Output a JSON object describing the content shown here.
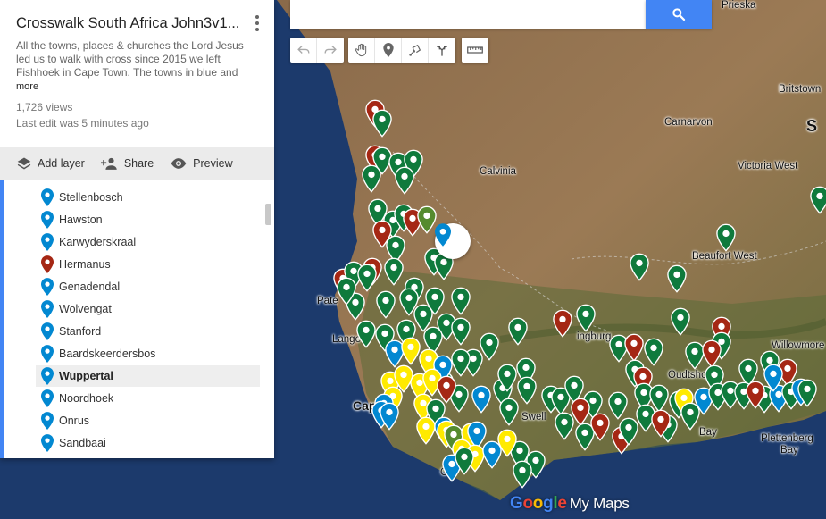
{
  "search": {
    "placeholder": "",
    "value": ""
  },
  "panel": {
    "title": "Crosswalk South Africa John3v1...",
    "description": "All the towns, places & churches the Lord Jesus led us to walk with cross since 2015 we left Fishhoek in Cape Town. The towns in blue and",
    "more_label": "more",
    "views": "1,726 views",
    "last_edit": "Last edit was 5 minutes ago",
    "actions": {
      "add_layer": "Add layer",
      "share": "Share",
      "preview": "Preview"
    },
    "items": [
      {
        "label": "Stellenbosch",
        "color": "#0288d1",
        "selected": false
      },
      {
        "label": "Hawston",
        "color": "#0288d1",
        "selected": false
      },
      {
        "label": "Karwyderskraal",
        "color": "#0288d1",
        "selected": false
      },
      {
        "label": "Hermanus",
        "color": "#a52714",
        "selected": false
      },
      {
        "label": "Genadendal",
        "color": "#0288d1",
        "selected": false
      },
      {
        "label": "Wolvengat",
        "color": "#0288d1",
        "selected": false
      },
      {
        "label": "Stanford",
        "color": "#0288d1",
        "selected": false
      },
      {
        "label": "Baardskeerdersbos",
        "color": "#0288d1",
        "selected": false
      },
      {
        "label": "Wuppertal",
        "color": "#0288d1",
        "selected": true
      },
      {
        "label": "Noordhoek",
        "color": "#0288d1",
        "selected": false
      },
      {
        "label": "Onrus",
        "color": "#0288d1",
        "selected": false
      },
      {
        "label": "Sandbaai",
        "color": "#0288d1",
        "selected": false
      }
    ]
  },
  "map": {
    "places": {
      "prieska": "Prieska",
      "britstown": "Britstown",
      "carnarvon": "Carnarvon",
      "calvinia": "Calvinia",
      "victoria_west": "Victoria West",
      "beaufort_west": "Beaufort West",
      "paternoster": "Pate",
      "langebaan": "Lange",
      "oudtshoorn": "Oudtshoorn",
      "willowmore": "Willowmore",
      "ladismith": "ingburg",
      "cape_town": "Cap",
      "swellendam": "Swell",
      "mossel_bay": "Bay",
      "plettenberg_bay_1": "Plettenberg",
      "plettenberg_bay_2": "Bay",
      "gansbaai": "Ga",
      "south_edge": "S"
    },
    "pin_colors": {
      "blue": "#0288d1",
      "green": "#0f7a3c",
      "red": "#a52714",
      "yellow": "#ffea00",
      "olive": "#558b2f"
    }
  },
  "toolbar": [
    "undo-icon",
    "redo-icon",
    "hand-icon",
    "marker-icon",
    "draw-line-icon",
    "directions-icon",
    "ruler-icon"
  ],
  "logo": {
    "google": "Google",
    "my_maps": "My Maps"
  }
}
